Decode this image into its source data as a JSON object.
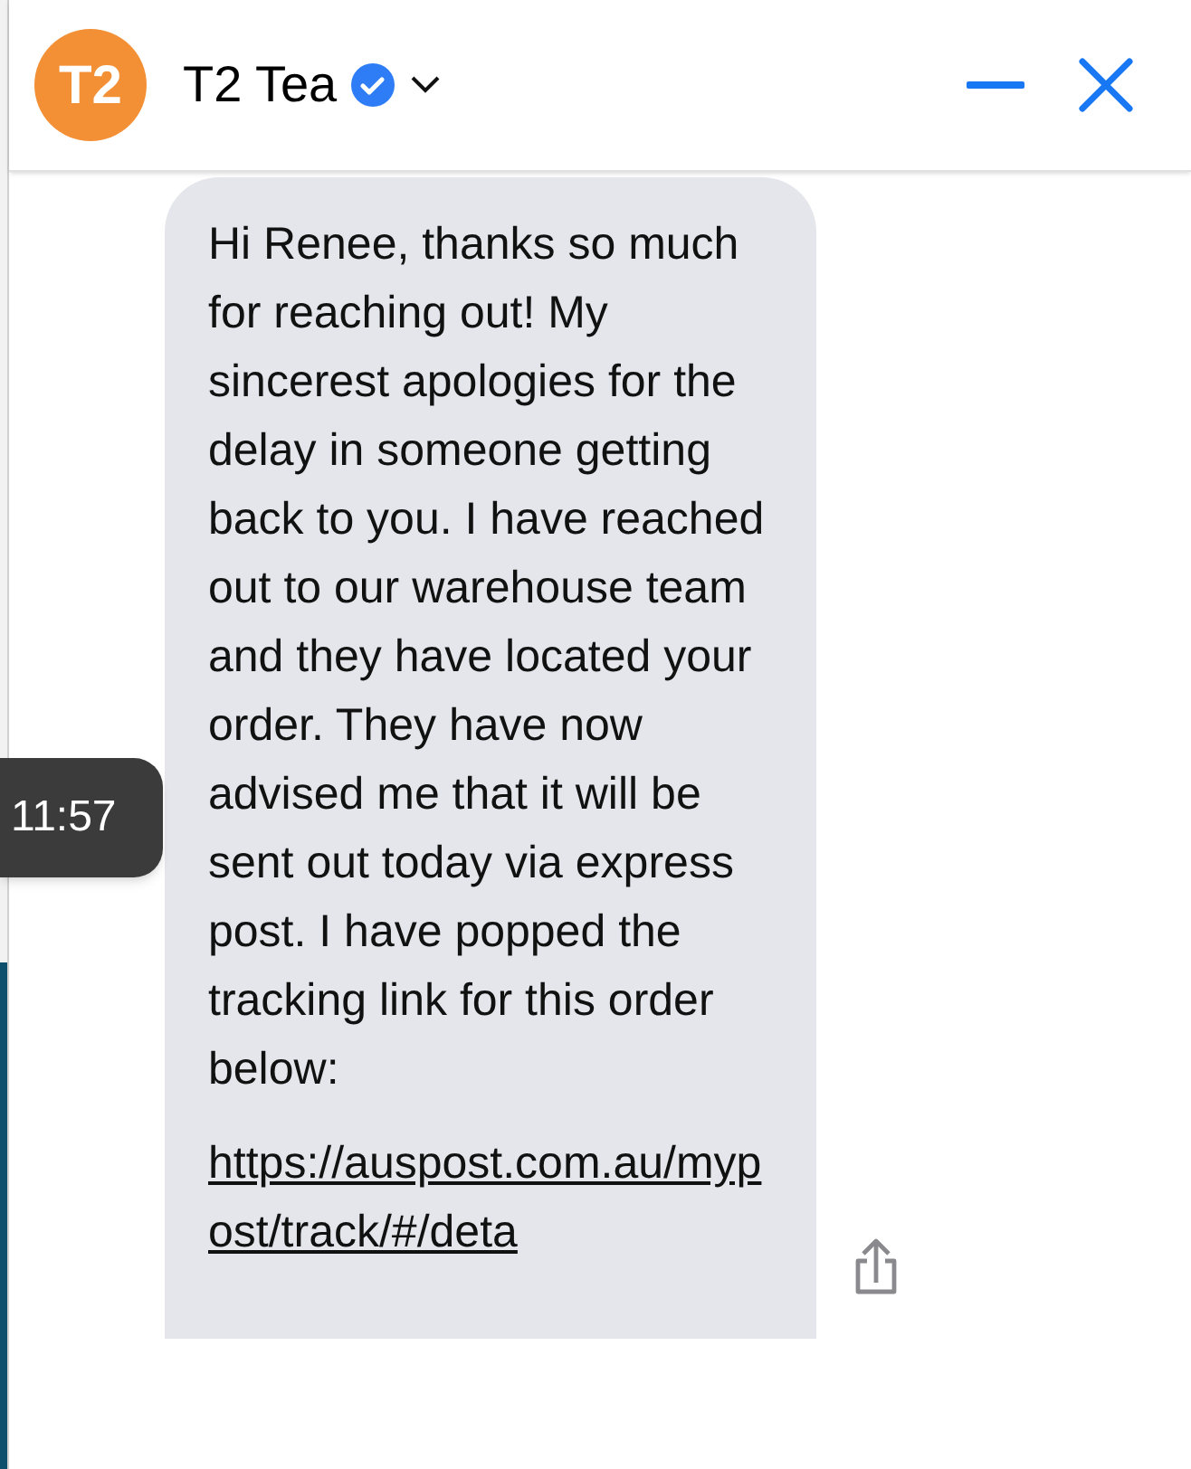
{
  "header": {
    "avatar_text": "T2",
    "name": "T2 Tea",
    "verified": true
  },
  "message": {
    "text": "Hi Renee, thanks so much for reaching out! My sincerest apologies for the delay in someone getting back to you. I have reached out to our warehouse team and they have located your order. They have now advised me that it will be sent out today via express post. I have popped the tracking link for this order below:",
    "link": "https://auspost.com.au/mypost/track/#/deta"
  },
  "tooltip": {
    "time": "11:57"
  }
}
